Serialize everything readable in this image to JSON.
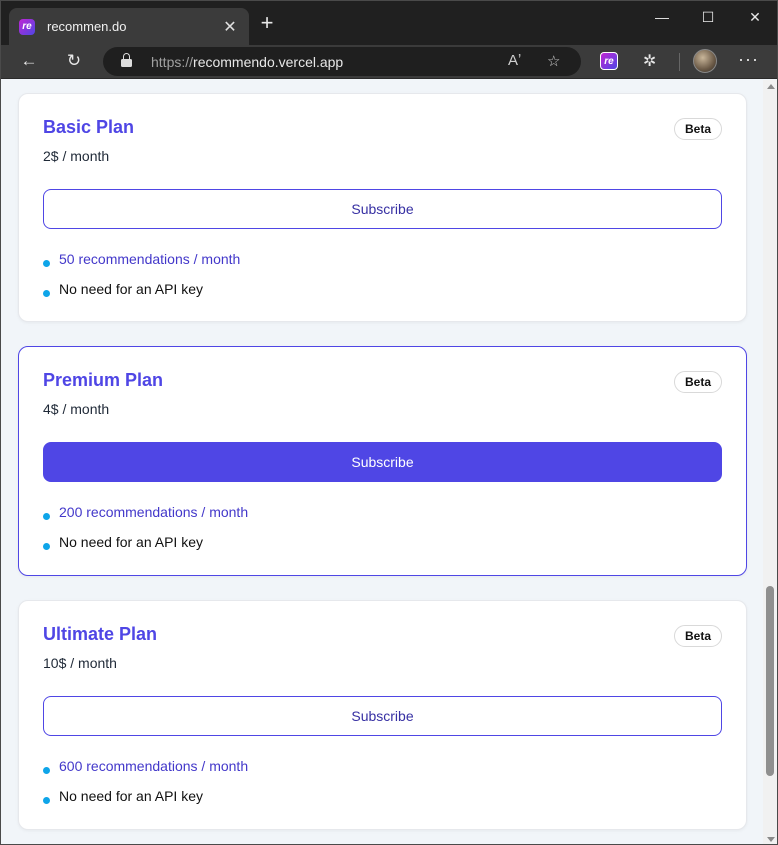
{
  "browser": {
    "tab_title": "recommen.do",
    "favicon_text": "re",
    "url_proto": "https://",
    "url_host": "recommendo.vercel.app",
    "icons": {
      "tab_close": "close-icon",
      "new_tab": "plus-icon",
      "back": "back-arrow-icon",
      "reload": "reload-icon",
      "read_aloud": "read-aloud-icon",
      "favorite": "star-icon",
      "extension": "recommendo-extension-icon",
      "extensions": "puzzle-icon",
      "profile": "avatar",
      "menu": "more-icon"
    }
  },
  "plans": [
    {
      "title": "Basic Plan",
      "badge": "Beta",
      "price": "2$ / month",
      "button": "Subscribe",
      "features": [
        "50 recommendations / month",
        "No need for an API key"
      ]
    },
    {
      "title": "Premium Plan",
      "badge": "Beta",
      "price": "4$ / month",
      "button": "Subscribe",
      "features": [
        "200 recommendations / month",
        "No need for an API key"
      ]
    },
    {
      "title": "Ultimate Plan",
      "badge": "Beta",
      "price": "10$ / month",
      "button": "Subscribe",
      "features": [
        "600 recommendations / month",
        "No need for an API key"
      ]
    }
  ],
  "colors": {
    "accent": "#4f46e5",
    "bullet": "#0ea5e9",
    "page_bg": "#f1f5f9"
  }
}
